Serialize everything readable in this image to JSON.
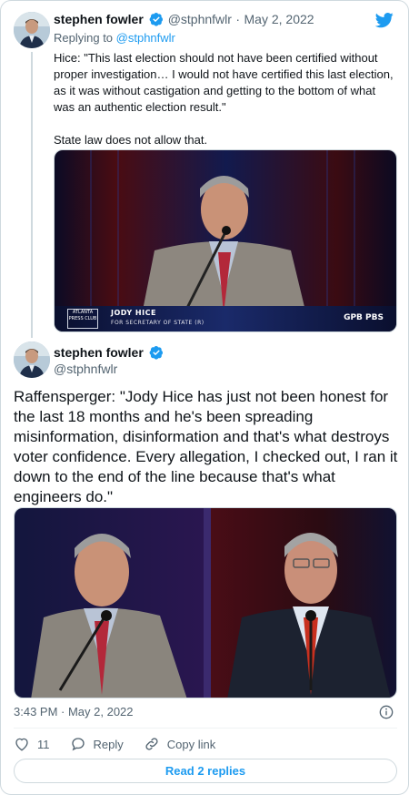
{
  "colors": {
    "accent": "#1d9bf0",
    "muted": "#536471",
    "text": "#0f1419",
    "border": "#cfd9de"
  },
  "reply_tweet": {
    "author_name": "stephen fowler",
    "author_handle": "@stphnfwlr",
    "separator": "·",
    "date": "May 2, 2022",
    "replying_prefix": "Replying to ",
    "replying_to": "@stphnfwlr",
    "text": "Hice: \"This last election should not have been certified without proper investigation… I would not have certified this last election, as it was without castigation and getting to the bottom of what was an authentic election result.\"\n\nState law does not allow that.",
    "media": {
      "lower_third_name": "JODY HICE",
      "lower_third_title": "FOR SECRETARY OF STATE (R)",
      "logo_text": "ATLANTA PRESS CLUB",
      "network": "GPB PBS"
    }
  },
  "main_tweet": {
    "author_name": "stephen fowler",
    "author_handle": "@stphnfwlr",
    "text": "Raffensperger: \"Jody Hice has just not been honest for the last 18 months and he's been spreading misinformation, disinformation and that's what destroys voter confidence. Every allegation, I checked out, I ran it down to the end of the line because that's what engineers do.\"",
    "timestamp": "3:43 PM · May 2, 2022",
    "actions": {
      "likes": "11",
      "reply_label": "Reply",
      "copy_label": "Copy link"
    },
    "read_replies_label": "Read 2 replies"
  },
  "icons": {
    "brand": "twitter-bird-icon",
    "verified": "verified-badge-icon",
    "info": "info-icon",
    "like": "heart-icon",
    "reply": "reply-bubble-icon",
    "copy": "link-icon"
  }
}
